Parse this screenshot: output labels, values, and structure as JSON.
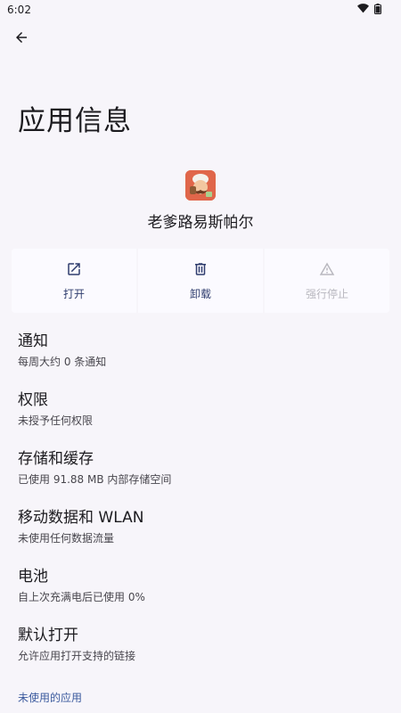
{
  "status": {
    "time": "6:02"
  },
  "icons": {
    "back": "arrow-back-icon",
    "wifi": "wifi-icon",
    "battery": "battery-icon",
    "open": "open-external-icon",
    "uninstall": "trash-icon",
    "force_stop": "warning-icon"
  },
  "colors": {
    "accent": "#2f3d6e",
    "link": "#3b5a9e",
    "disabled": "#b9b8bf",
    "app_icon_bg": "#e0664a"
  },
  "page": {
    "title": "应用信息"
  },
  "app": {
    "name": "老爹路易斯帕尔"
  },
  "actions": [
    {
      "label": "打开",
      "enabled": true
    },
    {
      "label": "卸载",
      "enabled": true
    },
    {
      "label": "强行停止",
      "enabled": false
    }
  ],
  "settings": [
    {
      "title": "通知",
      "subtitle": "每周大约 0 条通知"
    },
    {
      "title": "权限",
      "subtitle": "未授予任何权限"
    },
    {
      "title": "存储和缓存",
      "subtitle": "已使用 91.88 MB 内部存储空间"
    },
    {
      "title": "移动数据和 WLAN",
      "subtitle": "未使用任何数据流量"
    },
    {
      "title": "电池",
      "subtitle": "自上次充满电后已使用 0%"
    },
    {
      "title": "默认打开",
      "subtitle": "允许应用打开支持的链接"
    }
  ],
  "unused_apps_link": "未使用的应用"
}
